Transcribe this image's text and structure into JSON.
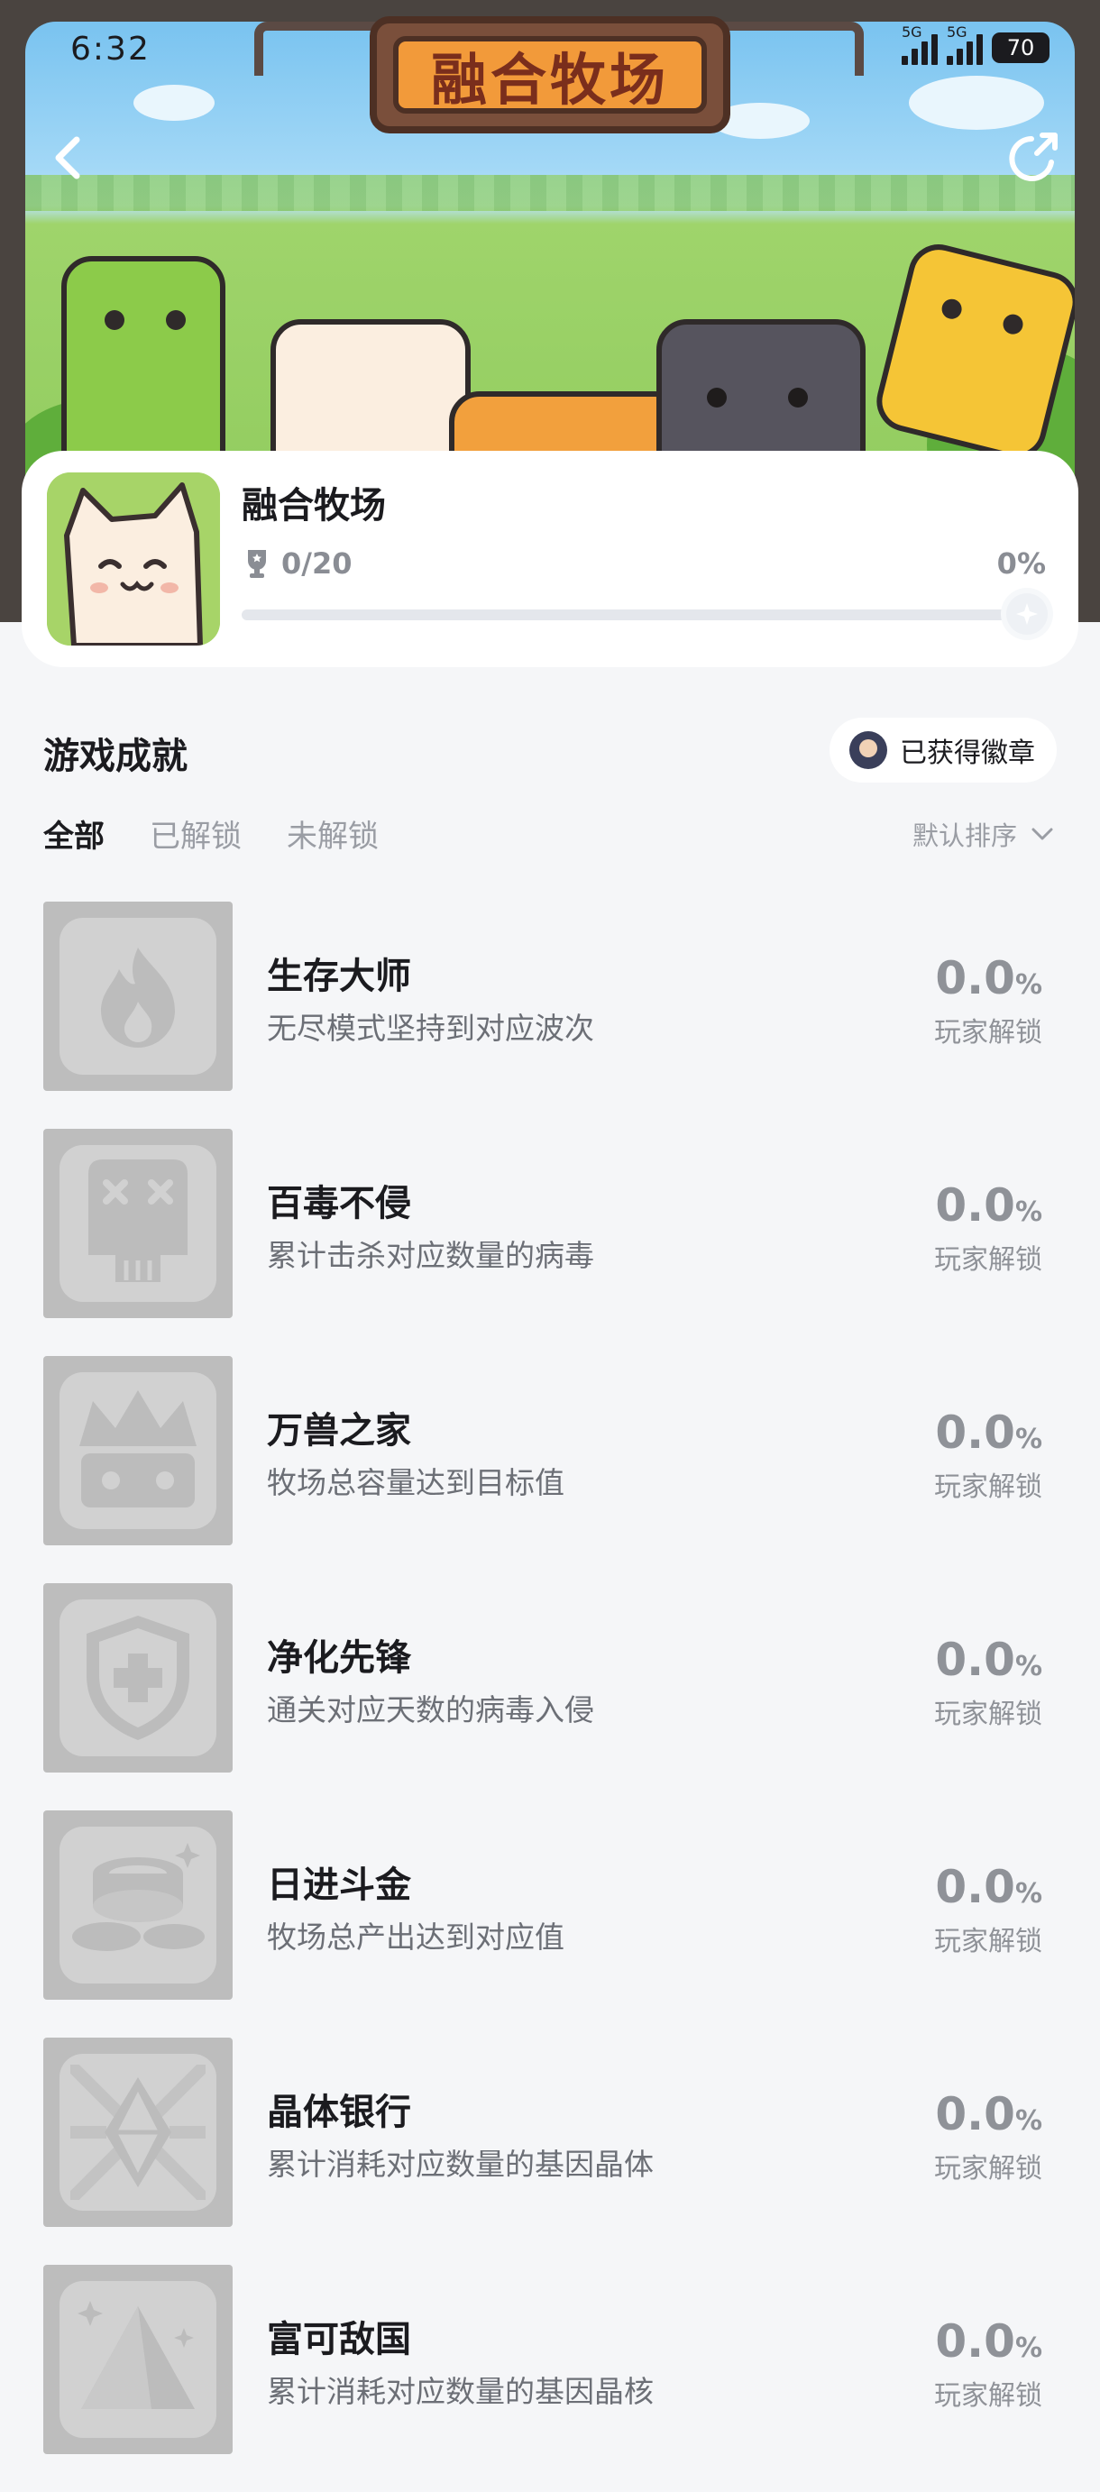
{
  "status_bar": {
    "time": "6:32",
    "network_1": "5G",
    "network_2": "5G",
    "battery": "70"
  },
  "banner": {
    "board_text": "融合牧场"
  },
  "game": {
    "name": "融合牧场",
    "trophy_count": "0/20",
    "progress_percent": "0%",
    "progress_value": 0
  },
  "section": {
    "title": "游戏成就",
    "badge_button_label": "已获得徽章"
  },
  "tabs": [
    {
      "label": "全部",
      "active": true
    },
    {
      "label": "已解锁",
      "active": false
    },
    {
      "label": "未解锁",
      "active": false
    }
  ],
  "sort": {
    "label": "默认排序"
  },
  "achievements": [
    {
      "title": "生存大师",
      "description": "无尽模式坚持到对应波次",
      "rate": "0.0",
      "unit": "%",
      "rate_label": "玩家解锁",
      "icon": "flame-icon"
    },
    {
      "title": "百毒不侵",
      "description": "累计击杀对应数量的病毒",
      "rate": "0.0",
      "unit": "%",
      "rate_label": "玩家解锁",
      "icon": "skull-icon"
    },
    {
      "title": "万兽之家",
      "description": "牧场总容量达到目标值",
      "rate": "0.0",
      "unit": "%",
      "rate_label": "玩家解锁",
      "icon": "crown-icon"
    },
    {
      "title": "净化先锋",
      "description": "通关对应天数的病毒入侵",
      "rate": "0.0",
      "unit": "%",
      "rate_label": "玩家解锁",
      "icon": "shield-cross-icon"
    },
    {
      "title": "日进斗金",
      "description": "牧场总产出达到对应值",
      "rate": "0.0",
      "unit": "%",
      "rate_label": "玩家解锁",
      "icon": "coins-icon"
    },
    {
      "title": "晶体银行",
      "description": "累计消耗对应数量的基因晶体",
      "rate": "0.0",
      "unit": "%",
      "rate_label": "玩家解锁",
      "icon": "crystal-icon"
    },
    {
      "title": "富可敌国",
      "description": "累计消耗对应数量的基因晶核",
      "rate": "0.0",
      "unit": "%",
      "rate_label": "玩家解锁",
      "icon": "pyramid-icon"
    }
  ]
}
